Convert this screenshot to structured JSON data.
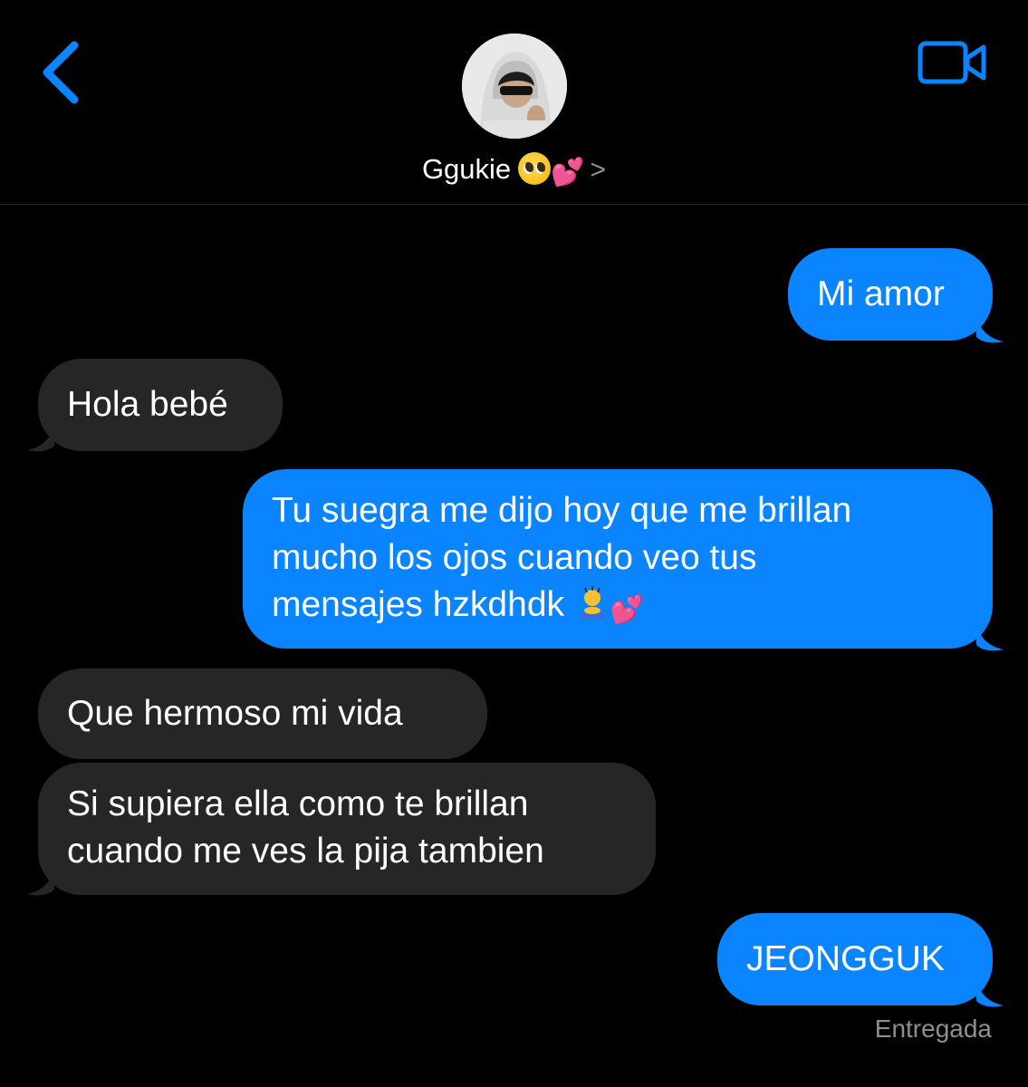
{
  "header": {
    "contact_name": "Ggukie",
    "contact_emojis": "💕",
    "chevron": ">",
    "back_icon": "chevron-left-icon",
    "video_icon": "video-camera-icon",
    "accent_color": "#0a84ff"
  },
  "messages": [
    {
      "direction": "sent",
      "lines": [
        "Mi amor"
      ]
    },
    {
      "direction": "received",
      "lines": [
        "Hola bebé"
      ]
    },
    {
      "direction": "sent",
      "lines": [
        "Tu suegra me dijo hoy que me brillan",
        "mucho los ojos cuando veo tus",
        "mensajes hzkdhdk"
      ],
      "trailing_emojis": "💕"
    },
    {
      "direction": "received",
      "lines": [
        "Que hermoso mi vida"
      ]
    },
    {
      "direction": "received",
      "lines": [
        "Si supiera ella como te brillan",
        "cuando me ves la pija tambien"
      ]
    },
    {
      "direction": "sent",
      "lines": [
        "JEONGGUK"
      ]
    }
  ],
  "status": "Entregada",
  "colors": {
    "sent_bubble": "#0a84ff",
    "received_bubble": "#262628",
    "background": "#000000"
  }
}
